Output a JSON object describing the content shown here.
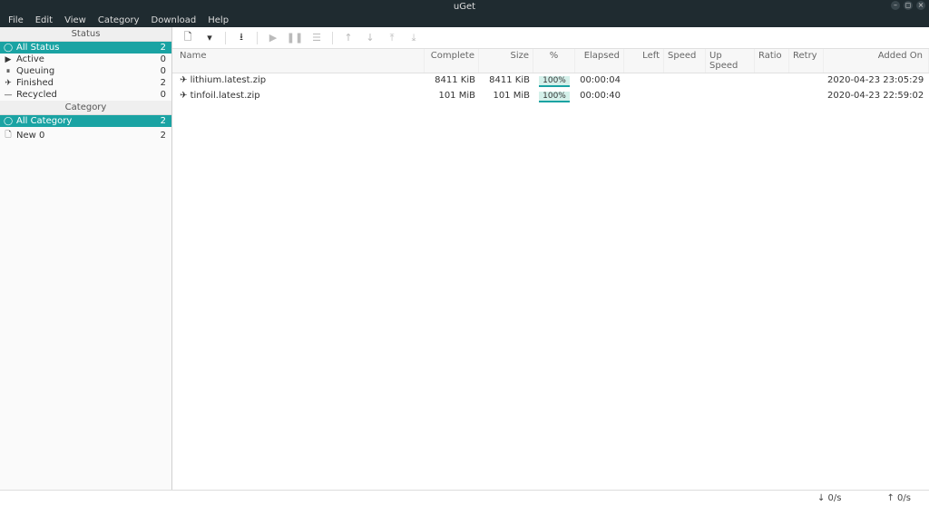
{
  "window": {
    "title": "uGet"
  },
  "menu": [
    "File",
    "Edit",
    "View",
    "Category",
    "Download",
    "Help"
  ],
  "sidebar": {
    "status_header": "Status",
    "status": [
      {
        "icon": "◯",
        "label": "All Status",
        "count": "2",
        "selected": true
      },
      {
        "icon": "▶",
        "label": "Active",
        "count": "0"
      },
      {
        "icon": "⏸",
        "label": "Queuing",
        "count": "0"
      },
      {
        "icon": "✈",
        "label": "Finished",
        "count": "2"
      },
      {
        "icon": "—",
        "label": "Recycled",
        "count": "0"
      }
    ],
    "category_header": "Category",
    "category": [
      {
        "icon": "◯",
        "label": "All Category",
        "count": "2",
        "selected": true
      },
      {
        "icon": "🗋",
        "label": "New 0",
        "count": "2"
      }
    ]
  },
  "toolbar": [
    {
      "name": "new-icon",
      "glyph": "🗋",
      "intr": true
    },
    {
      "name": "dropdown-icon",
      "glyph": "▾",
      "intr": true
    },
    {
      "name": "sep"
    },
    {
      "name": "save-icon",
      "glyph": "⭳",
      "intr": true
    },
    {
      "name": "sep"
    },
    {
      "name": "play-icon",
      "glyph": "▶",
      "intr": false
    },
    {
      "name": "pause-icon",
      "glyph": "❚❚",
      "intr": false
    },
    {
      "name": "properties-icon",
      "glyph": "☰",
      "intr": false
    },
    {
      "name": "sep"
    },
    {
      "name": "up-icon",
      "glyph": "↑",
      "intr": false
    },
    {
      "name": "down-icon",
      "glyph": "↓",
      "intr": false
    },
    {
      "name": "top-icon",
      "glyph": "⤒",
      "intr": false
    },
    {
      "name": "bottom-icon",
      "glyph": "⤓",
      "intr": false
    }
  ],
  "columns": {
    "name": "Name",
    "complete": "Complete",
    "size": "Size",
    "pct": "%",
    "elapsed": "Elapsed",
    "left": "Left",
    "speed": "Speed",
    "up": "Up Speed",
    "ratio": "Ratio",
    "retry": "Retry",
    "added": "Added On"
  },
  "rows": [
    {
      "name": "lithium.latest.zip",
      "complete": "8411 KiB",
      "size": "8411 KiB",
      "pct": "100%",
      "elapsed": "00:00:04",
      "left": "",
      "added": "2020-04-23 23:05:29"
    },
    {
      "name": "tinfoil.latest.zip",
      "complete": "101 MiB",
      "size": "101 MiB",
      "pct": "100%",
      "elapsed": "00:00:40",
      "left": "",
      "added": "2020-04-23 22:59:02"
    }
  ],
  "status": {
    "down": "↓  0/s",
    "up": "↑  0/s"
  }
}
